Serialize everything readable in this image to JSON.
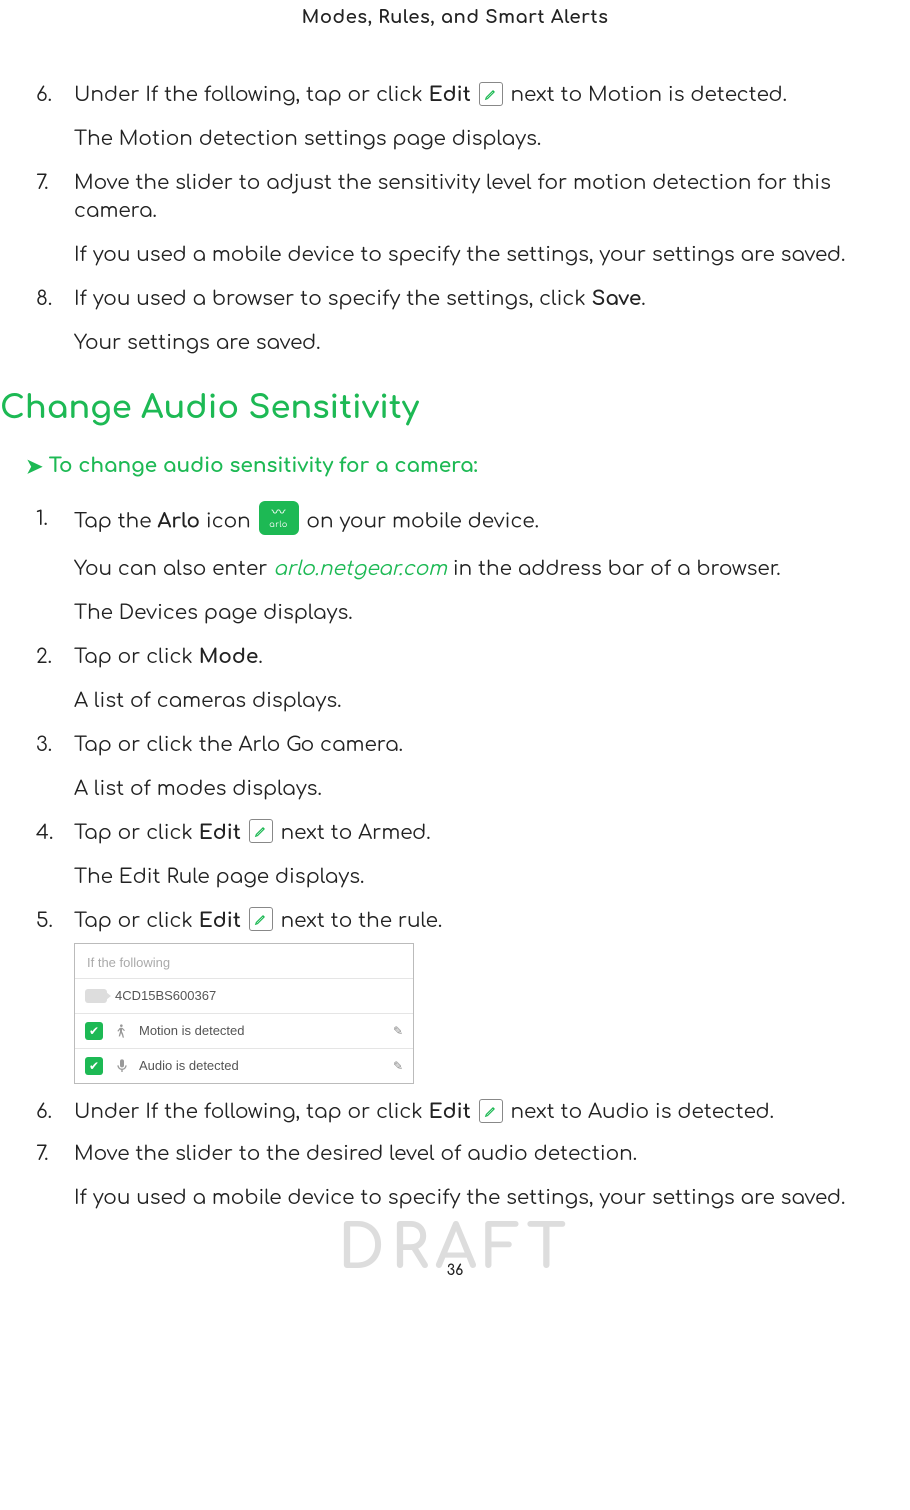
{
  "header": "Modes, Rules, and Smart Alerts",
  "watermark": "DRAFT",
  "page_number": "36",
  "topSteps": [
    {
      "n": "6.",
      "pre": "Under If the following, tap or click ",
      "bold": "Edit",
      "post": " next to Motion is detected.",
      "para": "The Motion detection settings page displays."
    },
    {
      "n": "7.",
      "pre": "Move the slider to adjust the sensitivity level for motion detection for this camera.",
      "bold": "",
      "post": "",
      "para": "If you used a mobile device to specify the settings, your settings are saved."
    },
    {
      "n": "8.",
      "pre": "If you used a browser to specify the settings, click ",
      "bold": "Save",
      "post": ".",
      "para": "Your settings are saved."
    }
  ],
  "section_title": "Change Audio Sensitivity",
  "subhead": "To change audio sensitivity for a camera:",
  "audioSteps": {
    "s1": {
      "n": "1.",
      "pre": "Tap the ",
      "bold": "Arlo",
      "mid": " icon ",
      "post": " on your mobile device.",
      "p1a": "You can also enter ",
      "link": "arlo.netgear.com",
      "p1b": " in the address bar of a browser.",
      "p2": "The Devices page displays."
    },
    "s2": {
      "n": "2.",
      "pre": "Tap or click ",
      "bold": "Mode",
      "post": ".",
      "para": "A list of cameras displays."
    },
    "s3": {
      "n": "3.",
      "text": "Tap or click the Arlo Go camera.",
      "para": "A list of modes displays."
    },
    "s4": {
      "n": "4.",
      "pre": "Tap or click ",
      "bold": "Edit",
      "post": " next to Armed.",
      "para": "The Edit Rule page displays."
    },
    "s5": {
      "n": "5.",
      "pre": "Tap or click ",
      "bold": "Edit",
      "post": " next to the rule."
    },
    "s6": {
      "n": "6.",
      "pre": "Under If the following, tap or click ",
      "bold": "Edit",
      "post": " next to Audio is detected."
    },
    "s7": {
      "n": "7.",
      "text": "Move the slider to the desired level of audio detection.",
      "para": "If you used a mobile device to specify the settings, your settings are saved."
    }
  },
  "miniShot": {
    "header": "If the following",
    "device": "4CD15BS600367",
    "row1": "Motion is detected",
    "row2": "Audio is detected"
  },
  "arlo_badge_text": "arlo"
}
